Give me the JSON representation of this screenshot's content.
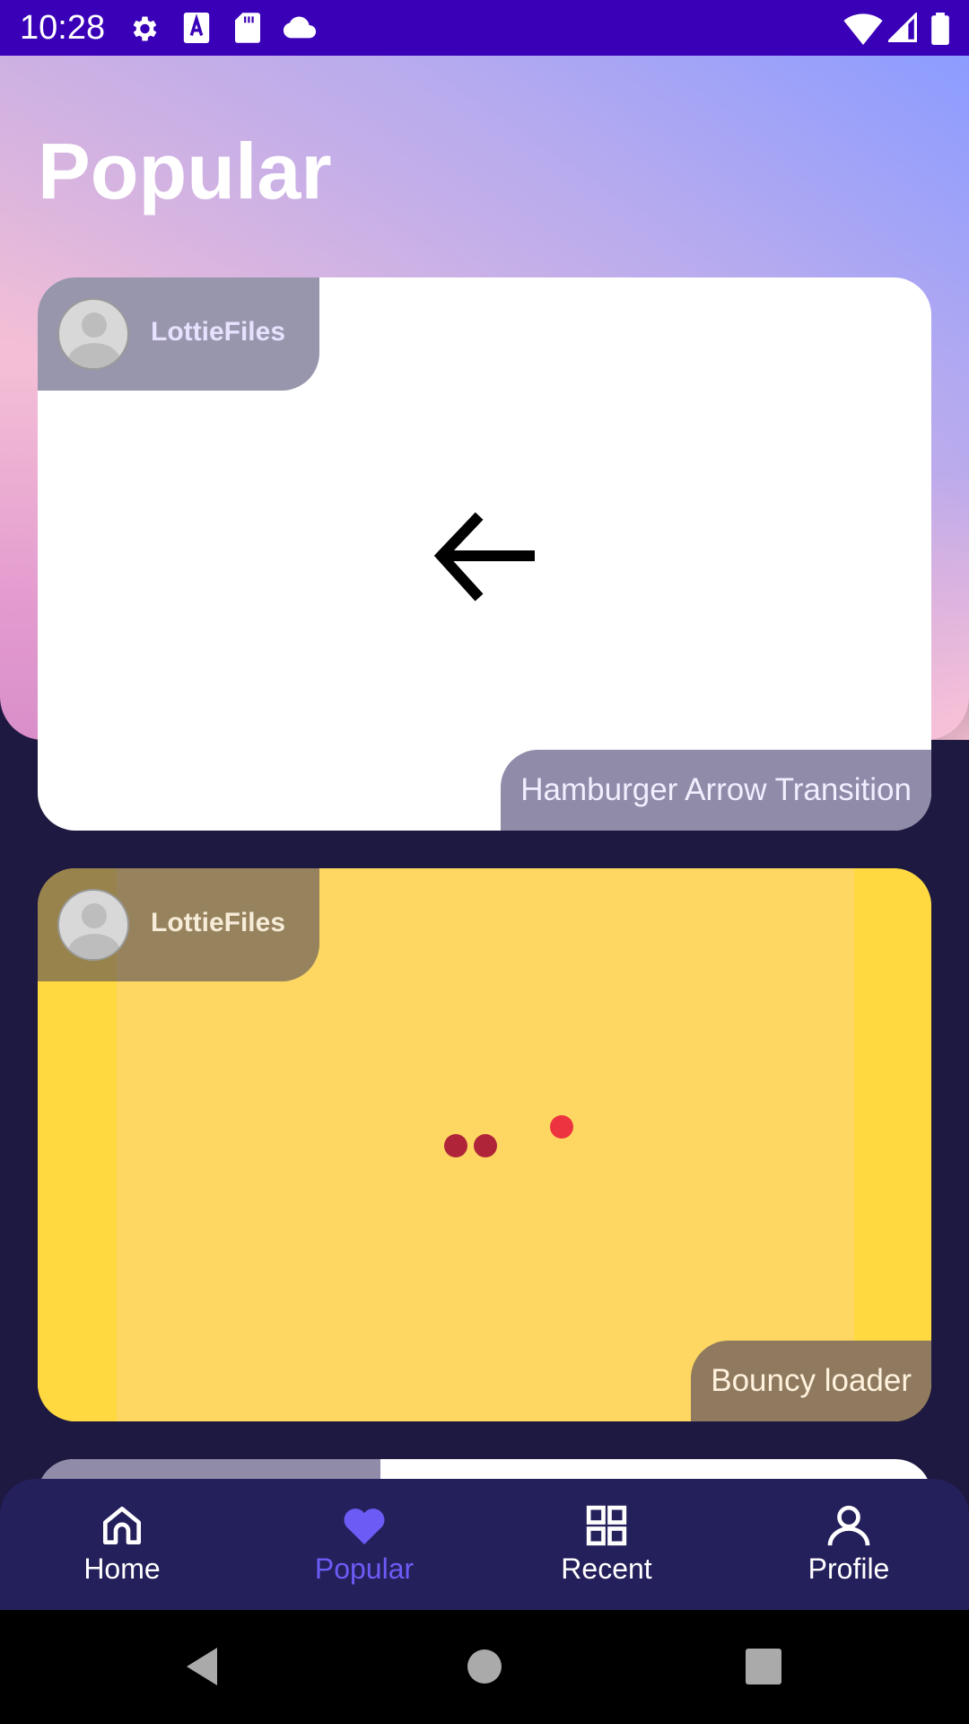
{
  "status_bar": {
    "time": "10:28",
    "left_icons": [
      "gear-icon",
      "font-icon",
      "sd-card-icon",
      "cloud-icon"
    ],
    "right_icons": [
      "wifi-icon",
      "signal-icon",
      "battery-icon"
    ]
  },
  "page": {
    "title": "Popular"
  },
  "cards": [
    {
      "author": "LottieFiles",
      "title": "Hamburger Arrow Transition",
      "animation_icon": "arrow-left-icon",
      "background": "#ffffff"
    },
    {
      "author": "LottieFiles",
      "title": "Bouncy loader",
      "animation_icon": "bouncing-dots-icon",
      "background": "#fdd762"
    },
    {
      "author": "",
      "title": "",
      "background": "#ffffff"
    }
  ],
  "bottom_nav": {
    "items": [
      {
        "label": "Home",
        "icon": "home-icon",
        "active": false
      },
      {
        "label": "Popular",
        "icon": "heart-icon",
        "active": true
      },
      {
        "label": "Recent",
        "icon": "grid-icon",
        "active": false
      },
      {
        "label": "Profile",
        "icon": "person-icon",
        "active": false
      }
    ]
  },
  "system_nav": {
    "icons": [
      "back-icon",
      "home-circle-icon",
      "recents-square-icon"
    ]
  },
  "colors": {
    "status_bar": "#3a00b8",
    "background": "#1e1940",
    "nav_bar": "#24205b",
    "accent": "#6b5cf6",
    "card_yellow": "#fdd762",
    "dot_dark_red": "#b0243a",
    "dot_red": "#ee3340"
  }
}
